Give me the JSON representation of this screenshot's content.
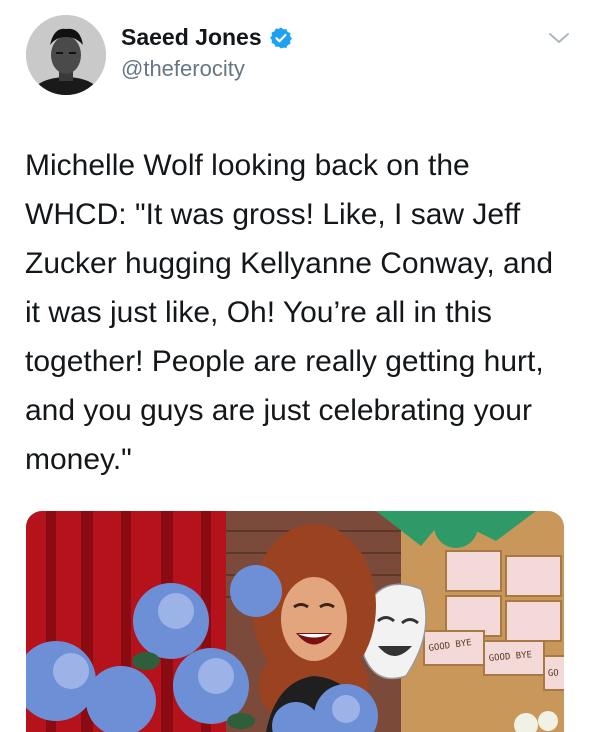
{
  "author": {
    "name": "Saeed Jones",
    "handle": "@theferocity",
    "verified": true
  },
  "tweet": {
    "text": "Michelle Wolf looking back on the WHCD: \"It was gross! Like, I saw Jeff Zucker hugging Kellyanne Conway, and it was just like, Oh! You’re all in this together! People are really getting hurt, and you guys are just celebrating your money.\""
  },
  "media": {
    "signs": [
      "GOOD BYE",
      "GOOD BYE",
      "GO"
    ]
  },
  "colors": {
    "verified": "#1da1f2",
    "secondary_text": "#657786",
    "caret": "#aab8c2"
  },
  "icons": {
    "verified": "verified-badge-icon",
    "caret": "chevron-down-icon"
  }
}
